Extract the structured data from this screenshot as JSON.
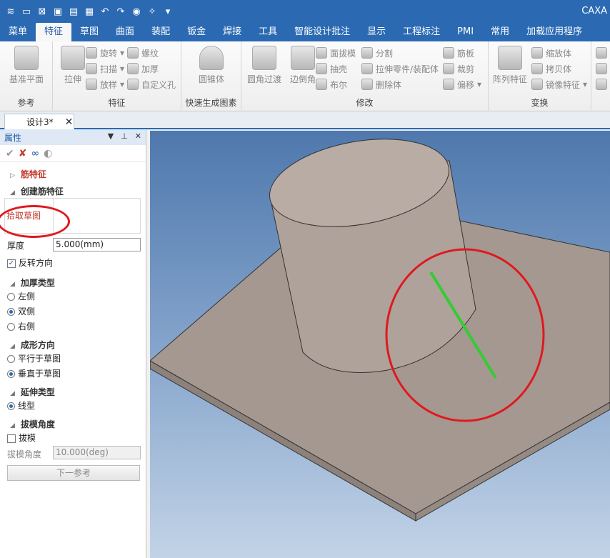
{
  "app": {
    "title": "CAXA"
  },
  "quick_access": [
    "logo-icon",
    "new-icon",
    "close-doc-icon",
    "preview-icon",
    "open-icon",
    "save-icon",
    "undo-icon",
    "redo-icon",
    "part-icon",
    "sparkle-icon",
    "dropdown-icon"
  ],
  "menu": {
    "tabs": [
      "菜单",
      "特征",
      "草图",
      "曲面",
      "装配",
      "钣金",
      "焊接",
      "工具",
      "智能设计批注",
      "显示",
      "工程标注",
      "PMI",
      "常用",
      "加载应用程序"
    ],
    "active": "特征"
  },
  "ribbon": {
    "groups": [
      {
        "title": "参考",
        "big": [
          "基准平面"
        ]
      },
      {
        "title": "特征",
        "big": [
          "拉伸"
        ],
        "small": [
          "旋转",
          "扫描",
          "放样",
          "螺纹",
          "加厚",
          "自定义孔"
        ]
      },
      {
        "title": "快速生成图素",
        "big": [
          "圆锥体"
        ]
      },
      {
        "title": "修改",
        "big": [
          "圆角过渡",
          "边倒角"
        ],
        "small": [
          "面拔模",
          "抽壳",
          "布尔",
          "分割",
          "拉伸零件/装配体",
          "删除体",
          "筋板",
          "裁剪",
          "偏移"
        ]
      },
      {
        "title": "变换",
        "big": [
          "阵列特征"
        ],
        "small": [
          "缩放体",
          "拷贝体",
          "镜像特征"
        ]
      }
    ]
  },
  "document": {
    "tab": "设计3*"
  },
  "panel": {
    "title": "属性",
    "feature_name": "筋特征",
    "create_section": "创建筋特征",
    "pick_sketch": "拾取草图",
    "thickness_label": "厚度",
    "thickness_value": "5.000(mm)",
    "reverse_label": "反转方向",
    "reverse_checked": true,
    "thicken_section": "加厚类型",
    "thicken_options": [
      "左侧",
      "双侧",
      "右侧"
    ],
    "thicken_selected": "双侧",
    "direction_section": "成形方向",
    "direction_options": [
      "平行于草图",
      "垂直于草图"
    ],
    "direction_selected": "垂直于草图",
    "extend_section": "延伸类型",
    "extend_options": [
      "线型"
    ],
    "extend_selected": "线型",
    "draft_section": "拔模角度",
    "draft_label": "拔模",
    "draft_checked": false,
    "draft_angle_label": "拔模角度",
    "draft_angle_value": "10.000(deg)",
    "next_button": "下一参考"
  },
  "colors": {
    "accent": "#2b6ab3",
    "model": "#a59890",
    "sketch_line": "#33cc33",
    "annotation": "#e0191f"
  }
}
